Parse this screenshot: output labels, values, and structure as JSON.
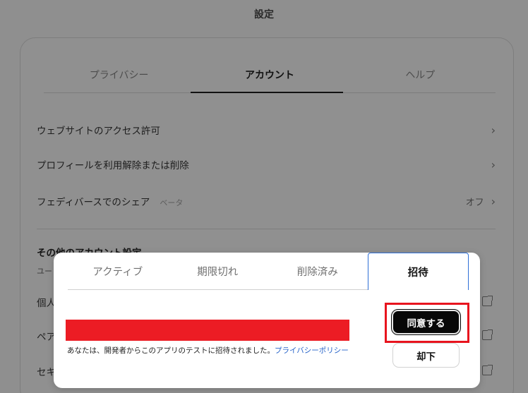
{
  "header": {
    "title": "設定"
  },
  "settings": {
    "tabs": [
      {
        "label": "プライバシー"
      },
      {
        "label": "アカウント"
      },
      {
        "label": "ヘルプ"
      }
    ],
    "rows": [
      {
        "label": "ウェブサイトのアクセス許可",
        "chevron": "›"
      },
      {
        "label": "プロフィールを利用解除または削除",
        "chevron": "›"
      },
      {
        "label": "フェディバースでのシェア",
        "badge": "ベータ",
        "value": "オフ",
        "chevron": "›"
      }
    ],
    "other_section_title": "その他のアカウント設定",
    "other_section_subtitle_partial": "ユー",
    "partial_rows": [
      "個人",
      "ペア",
      "セキ"
    ]
  },
  "dialog": {
    "tabs": [
      {
        "label": "アクティブ"
      },
      {
        "label": "期限切れ"
      },
      {
        "label": "削除済み"
      },
      {
        "label": "招待"
      }
    ],
    "message": "あなたは、開発者からこのアプリのテストに招待されました。",
    "privacy_link": "プライバシーポリシー",
    "accept_label": "同意する",
    "decline_label": "却下"
  },
  "colors": {
    "redaction": "#ec1c24",
    "highlight": "#e8141e",
    "link": "#2663c9",
    "selected_tab_border": "#2f6fd6"
  },
  "icons": [
    "chevron-right-icon",
    "external-link-icon"
  ]
}
